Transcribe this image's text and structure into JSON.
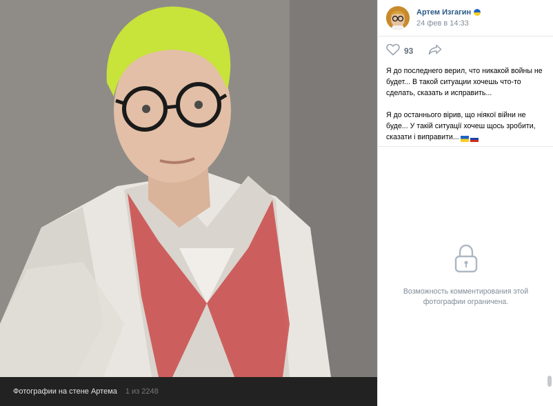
{
  "photo_viewer": {
    "album_label": "Фотографии на стене Артема",
    "counter": "1 из 2248"
  },
  "post": {
    "author_name": "Артем Изгагин",
    "date": "24 фев в 14:33",
    "likes": "93",
    "text_ru": "Я до последнего верил, что никакой войны не будет... В такой ситуации хочешь что-то сделать, сказать и исправить...",
    "text_ua": "Я до останнього вірив, що ніякої війни не буде... У такій ситуації хочеш щось зробити, сказати і виправити..."
  },
  "comments": {
    "closed_message": "Возможность комментирования этой фотографии ограничена."
  },
  "icons": {
    "like": "heart-icon",
    "share": "share-arrow-icon",
    "lock": "lock-icon",
    "verified_flag": "ukraine-flag-icon"
  },
  "colors": {
    "link": "#2a5885",
    "muted": "#818c99",
    "ukraine_blue": "#1e63c6",
    "ukraine_yellow": "#f5d020"
  }
}
